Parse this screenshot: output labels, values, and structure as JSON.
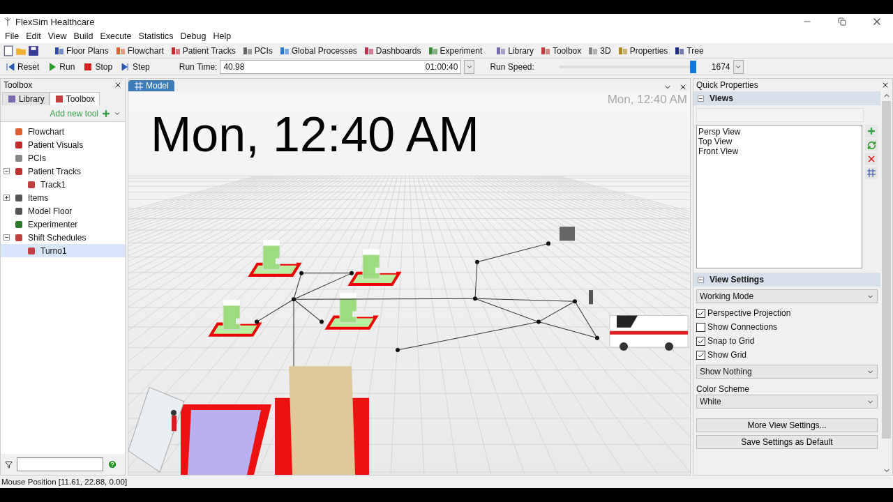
{
  "window": {
    "title": "FlexSim Healthcare"
  },
  "menu": [
    "File",
    "Edit",
    "View",
    "Build",
    "Execute",
    "Statistics",
    "Debug",
    "Help"
  ],
  "toolbar": [
    {
      "label": "Floor Plans"
    },
    {
      "label": "Flowchart"
    },
    {
      "label": "Patient Tracks"
    },
    {
      "label": "PCIs"
    },
    {
      "label": "Global Processes"
    },
    {
      "label": "Dashboards"
    },
    {
      "label": "Experiment"
    },
    {
      "label": "Library"
    },
    {
      "label": "Toolbox"
    },
    {
      "label": "3D"
    },
    {
      "label": "Properties"
    },
    {
      "label": "Tree"
    }
  ],
  "run_bar": {
    "buttons": [
      "Reset",
      "Run",
      "Stop",
      "Step"
    ],
    "run_time_label": "Run Time:",
    "run_time_value": "40.98",
    "run_time_clock": "01:00:40",
    "run_speed_label": "Run Speed:",
    "run_speed": {
      "level": 0.98
    },
    "run_speed_value": "1674"
  },
  "toolbox": {
    "title": "Toolbox",
    "tabs": [
      {
        "label": "Library",
        "selected": false
      },
      {
        "label": "Toolbox",
        "selected": true
      }
    ],
    "add_tool": "Add new tool",
    "tree": [
      {
        "label": "Flowchart",
        "kind": "leaf",
        "selected": false
      },
      {
        "label": "Patient Visuals",
        "kind": "leaf",
        "selected": false
      },
      {
        "label": "PCIs",
        "kind": "leaf",
        "selected": false
      },
      {
        "label": "Patient Tracks",
        "kind": "group",
        "expanded": true,
        "selected": false,
        "children": [
          {
            "label": "Track1",
            "kind": "leaf",
            "selected": false
          }
        ]
      },
      {
        "label": "Items",
        "kind": "group",
        "expanded": false,
        "selected": false
      },
      {
        "label": "Model Floor",
        "kind": "leaf",
        "selected": false
      },
      {
        "label": "Experimenter",
        "kind": "leaf",
        "selected": false
      },
      {
        "label": "Shift Schedules",
        "kind": "group",
        "expanded": true,
        "selected": false,
        "children": [
          {
            "label": "Turno1",
            "kind": "leaf",
            "selected": true
          }
        ]
      }
    ]
  },
  "model_view": {
    "tab": {
      "label": "Model",
      "selected": true
    },
    "clock": "Mon, 12:40 AM",
    "clock_faint": "Mon, 12:40 AM"
  },
  "quick_properties": {
    "title": "Quick Properties",
    "views": {
      "title": "Views",
      "expanded": true,
      "items": [
        "Persp View",
        "Top View",
        "Front View"
      ]
    },
    "view_settings": {
      "title": "View Settings",
      "expanded": true,
      "mode": "Working Mode",
      "checkboxes": [
        {
          "label": "Perspective Projection",
          "checked": true
        },
        {
          "label": "Show Connections",
          "checked": false
        },
        {
          "label": "Snap to Grid",
          "checked": true
        },
        {
          "label": "Show Grid",
          "checked": true
        }
      ],
      "display": "Show Nothing",
      "color_scheme_label": "Color Scheme",
      "color_scheme": "White",
      "buttons": [
        "More View Settings...",
        "Save Settings as Default"
      ]
    }
  },
  "status_bar": "Mouse Position [11.61, 22.88, 0.00]"
}
